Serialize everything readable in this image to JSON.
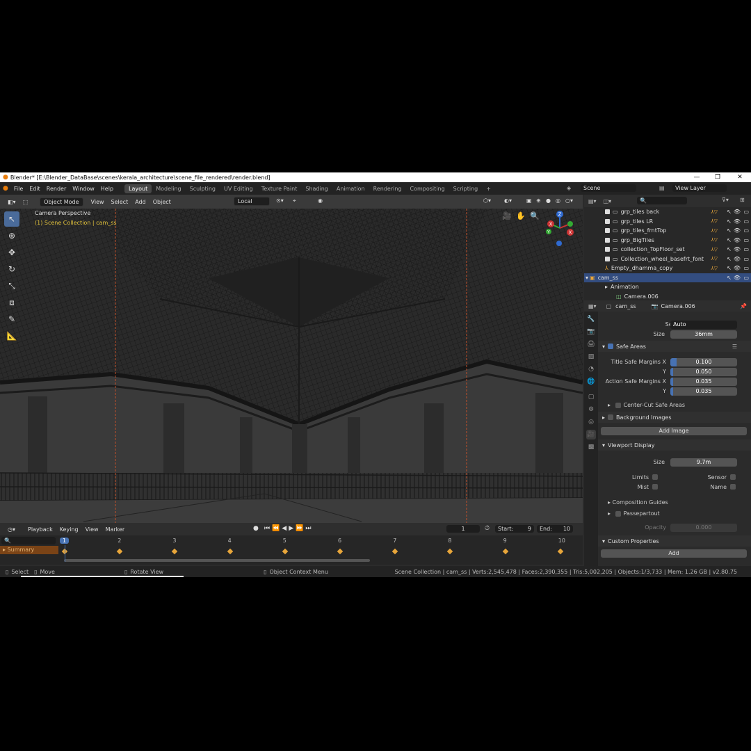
{
  "window": {
    "title": "Blender* [E:\\Blender_DataBase\\scenes\\kerala_architecture\\scene_file_rendered\\render.blend]"
  },
  "menu": [
    "File",
    "Edit",
    "Render",
    "Window",
    "Help"
  ],
  "workspaces": [
    "Layout",
    "Modeling",
    "Sculpting",
    "UV Editing",
    "Texture Paint",
    "Shading",
    "Animation",
    "Rendering",
    "Compositing",
    "Scripting"
  ],
  "scene": {
    "name": "Scene",
    "view_layer": "View Layer"
  },
  "viewport": {
    "mode": "Object Mode",
    "menus": [
      "View",
      "Select",
      "Add",
      "Object"
    ],
    "transform": "Local",
    "info_line1": "Camera Perspective",
    "info_line2": "(1) Scene Collection | cam_ss",
    "gizmo_axes": {
      "x": "X",
      "y": "Y",
      "z": "Z"
    }
  },
  "timeline": {
    "menus": [
      "Playback",
      "Keying",
      "View",
      "Marker"
    ],
    "current_frame": "1",
    "start_label": "Start:",
    "start": "9",
    "end_label": "End:",
    "end": "10",
    "frames": [
      "1",
      "2",
      "3",
      "4",
      "5",
      "6",
      "7",
      "8",
      "9",
      "10"
    ],
    "summary": "Summary"
  },
  "statusbar": {
    "select": "Select",
    "move": "Move",
    "rotate": "Rotate View",
    "context": "Object Context Menu",
    "stats": "Scene Collection | cam_ss | Verts:2,545,478 | Faces:2,390,355 | Tris:5,002,205 | Objects:1/3,733 | Mem: 1.26 GB | v2.80.75"
  },
  "outliner": {
    "items": [
      {
        "label": "grp_tiles back"
      },
      {
        "label": "grp_tiles LR"
      },
      {
        "label": "grp_tiles_frntTop"
      },
      {
        "label": "grp_BigTiles"
      },
      {
        "label": "collection_TopFloor_set"
      },
      {
        "label": "Collection_wheel_basefrt_font"
      },
      {
        "label": "Empty_dhamma_copy"
      },
      {
        "label": "cam_ss"
      },
      {
        "label": "Animation"
      },
      {
        "label": "Camera.006"
      }
    ]
  },
  "properties": {
    "object": "cam_ss",
    "data": "Camera.006",
    "sensor_fit_label": "Sensor Fit",
    "sensor_fit": "Auto",
    "size_label": "Size",
    "size": "36mm",
    "safe_areas": "Safe Areas",
    "title_safe_label": "Title Safe Margins X",
    "title_safe_x": "0.100",
    "title_safe_y": "0.050",
    "action_safe_label": "Action Safe Margins X",
    "action_safe_x": "0.035",
    "action_safe_y": "0.035",
    "y_label": "Y",
    "center_cut": "Center-Cut Safe Areas",
    "background_images": "Background Images",
    "add_image": "Add Image",
    "viewport_display": "Viewport Display",
    "vd_size_label": "Size",
    "vd_size": "9.7m",
    "limits": "Limits",
    "sensor": "Sensor",
    "mist": "Mist",
    "name": "Name",
    "composition_guides": "Composition Guides",
    "passepartout": "Passepartout",
    "opacity_label": "Opacity",
    "opacity": "0.000",
    "custom_properties": "Custom Properties",
    "add": "Add"
  },
  "colors": {
    "accent": "#4772b3",
    "object_orange": "#e8a63a",
    "info_yellow": "#e3c33c"
  }
}
